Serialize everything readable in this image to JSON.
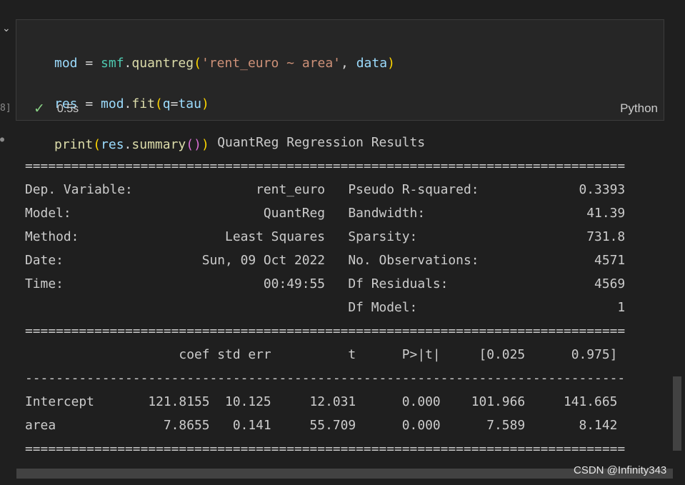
{
  "cell": {
    "exec_count": "8]",
    "code_lines": [
      "mod = smf.quantreg('rent_euro ~ area', data)",
      "res = mod.fit(q=tau)",
      "print(res.summary())"
    ],
    "exec_time": "0.5s",
    "language": "Python"
  },
  "output": {
    "title": "QuantReg Regression Results",
    "rule_double": "==============================================================================",
    "rule_single": "------------------------------------------------------------------------------",
    "info": [
      {
        "label": "Dep. Variable:",
        "value": "rent_euro",
        "label2": "Pseudo R-squared:",
        "value2": "0.3393"
      },
      {
        "label": "Model:",
        "value": "QuantReg",
        "label2": "Bandwidth:",
        "value2": "41.39"
      },
      {
        "label": "Method:",
        "value": "Least Squares",
        "label2": "Sparsity:",
        "value2": "731.8"
      },
      {
        "label": "Date:",
        "value": "Sun, 09 Oct 2022",
        "label2": "No. Observations:",
        "value2": "4571"
      },
      {
        "label": "Time:",
        "value": "00:49:55",
        "label2": "Df Residuals:",
        "value2": "4569"
      },
      {
        "label": "",
        "value": "",
        "label2": "Df Model:",
        "value2": "1"
      }
    ],
    "coef_headers": [
      "coef",
      "std err",
      "t",
      "P>|t|",
      "[0.025",
      "0.975]"
    ],
    "coef_rows": [
      {
        "name": "Intercept",
        "cells": [
          "121.8155",
          "10.125",
          "12.031",
          "0.000",
          "101.966",
          "141.665"
        ]
      },
      {
        "name": "area",
        "cells": [
          "7.8655",
          "0.141",
          "55.709",
          "0.000",
          "7.589",
          "8.142"
        ]
      }
    ]
  },
  "watermark": "CSDN @Infinity343"
}
